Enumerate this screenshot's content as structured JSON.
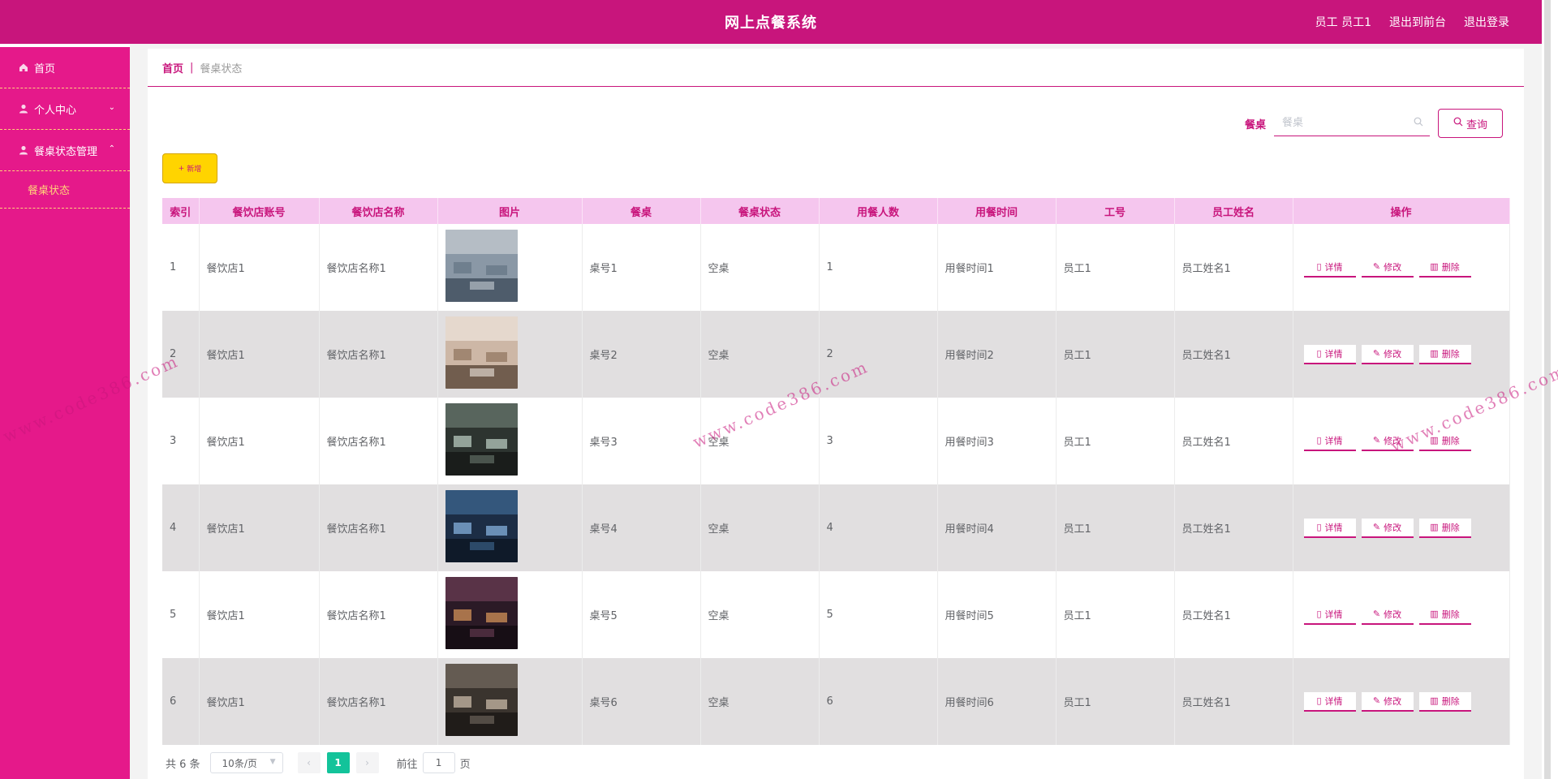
{
  "header": {
    "title": "网上点餐系统",
    "user": "员工 员工1",
    "back_to_front": "退出到前台",
    "logout": "退出登录"
  },
  "sidebar": {
    "items": [
      {
        "label": "首页",
        "icon": "home-icon"
      },
      {
        "label": "个人中心",
        "icon": "user-icon",
        "chevron": "⌄"
      },
      {
        "label": "餐桌状态管理",
        "icon": "user-icon",
        "chevron": "⌃"
      }
    ],
    "sub_items": [
      {
        "label": "餐桌状态"
      }
    ]
  },
  "breadcrumb": {
    "home": "首页",
    "sep": "|",
    "current": "餐桌状态"
  },
  "search": {
    "label": "餐桌",
    "placeholder": "餐桌",
    "button": "查询"
  },
  "toolbar": {
    "add_label": "新增"
  },
  "table": {
    "columns": [
      "索引",
      "餐饮店账号",
      "餐饮店名称",
      "图片",
      "餐桌",
      "餐桌状态",
      "用餐人数",
      "用餐时间",
      "工号",
      "员工姓名",
      "操作"
    ],
    "ops": {
      "detail": "详情",
      "edit": "修改",
      "delete": "删除"
    },
    "rows": [
      {
        "index": "1",
        "account": "餐饮店1",
        "name": "餐饮店名称1",
        "table": "桌号1",
        "status": "空桌",
        "people": "1",
        "time": "用餐时间1",
        "staff_no": "员工1",
        "staff_name": "员工姓名1"
      },
      {
        "index": "2",
        "account": "餐饮店1",
        "name": "餐饮店名称1",
        "table": "桌号2",
        "status": "空桌",
        "people": "2",
        "time": "用餐时间2",
        "staff_no": "员工1",
        "staff_name": "员工姓名1"
      },
      {
        "index": "3",
        "account": "餐饮店1",
        "name": "餐饮店名称1",
        "table": "桌号3",
        "status": "空桌",
        "people": "3",
        "time": "用餐时间3",
        "staff_no": "员工1",
        "staff_name": "员工姓名1"
      },
      {
        "index": "4",
        "account": "餐饮店1",
        "name": "餐饮店名称1",
        "table": "桌号4",
        "status": "空桌",
        "people": "4",
        "time": "用餐时间4",
        "staff_no": "员工1",
        "staff_name": "员工姓名1"
      },
      {
        "index": "5",
        "account": "餐饮店1",
        "name": "餐饮店名称1",
        "table": "桌号5",
        "status": "空桌",
        "people": "5",
        "time": "用餐时间5",
        "staff_no": "员工1",
        "staff_name": "员工姓名1"
      },
      {
        "index": "6",
        "account": "餐饮店1",
        "name": "餐饮店名称1",
        "table": "桌号6",
        "status": "空桌",
        "people": "6",
        "time": "用餐时间6",
        "staff_no": "员工1",
        "staff_name": "员工姓名1"
      }
    ]
  },
  "pagination": {
    "total": "共 6 条",
    "page_size": "10条/页",
    "prev": "‹",
    "next": "›",
    "current": "1",
    "goto_prefix": "前往",
    "goto_value": "1",
    "goto_suffix": "页"
  },
  "watermark": "www.code386.com",
  "colors": {
    "primary": "#c8157c",
    "sidebar": "#e5198a",
    "accent": "#ffd400",
    "page_active": "#13c39a"
  }
}
